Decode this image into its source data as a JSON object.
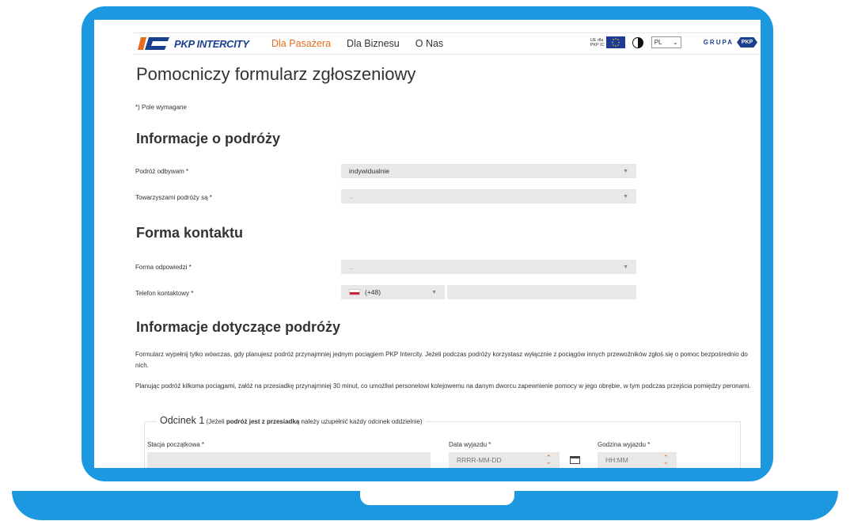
{
  "header": {
    "logo_text": "PKP INTERCITY",
    "nav": [
      {
        "label": "Dla Pasażera",
        "active": true
      },
      {
        "label": "Dla Biznesu",
        "active": false
      },
      {
        "label": "O Nas",
        "active": false
      }
    ],
    "ue_label": "UE dla PKP IC",
    "language": "PL",
    "grupa_label": "GRUPA",
    "pkp_badge": "PKP"
  },
  "form": {
    "title": "Pomocniczy formularz zgłoszeniowy",
    "required_note": "*) Pole wymagane",
    "section_travel": "Informacje o podróży",
    "travel_mode_label": "Podróż odbywam *",
    "travel_mode_value": "indywidualnie",
    "companions_label": "Towarzyszami podróży są *",
    "companions_value": "..",
    "section_contact": "Forma kontaktu",
    "response_form_label": "Forma odpowiedzi *",
    "response_form_value": "..",
    "phone_label": "Telefon kontaktowy *",
    "phone_prefix": "(+48)",
    "phone_value": "",
    "section_trip_info": "Informacje dotyczące podróży",
    "para1": "Formularz wypełnij tylko wówczas, gdy planujesz podróż przynajmniej jednym pociągiem PKP Intercity. Jeżeli podczas podróży korzystasz wyłącznie z pociągów innych przewoźników zgłoś się o pomoc bezpośrednio do nich.",
    "para2": "Planując podróż kilkoma pociągami, załóż na przesiadkę przynajmniej 30 minut, co umożliwi personelowi kolejowemu na danym dworcu zapewnienie pomocy w jego obrębie, w tym podczas przejścia pomiędzy peronami.",
    "segment": {
      "title": "Odcinek 1",
      "note_pre": "(Jeżeli ",
      "note_bold": "podróż jest z przesiadką",
      "note_post": " należy uzupełnić każdy odcinek oddzielnie)",
      "start_station_label": "Stacja początkowa *",
      "start_station_value": "",
      "date_label": "Data wyjazdu *",
      "date_placeholder": "RRRR-MM-DD",
      "time_label": "Godzina wyjazdu *",
      "time_placeholder": "HH:MM"
    }
  },
  "colors": {
    "frame": "#1c98e0",
    "accent": "#e86c1f",
    "brand": "#1b3f8f"
  }
}
